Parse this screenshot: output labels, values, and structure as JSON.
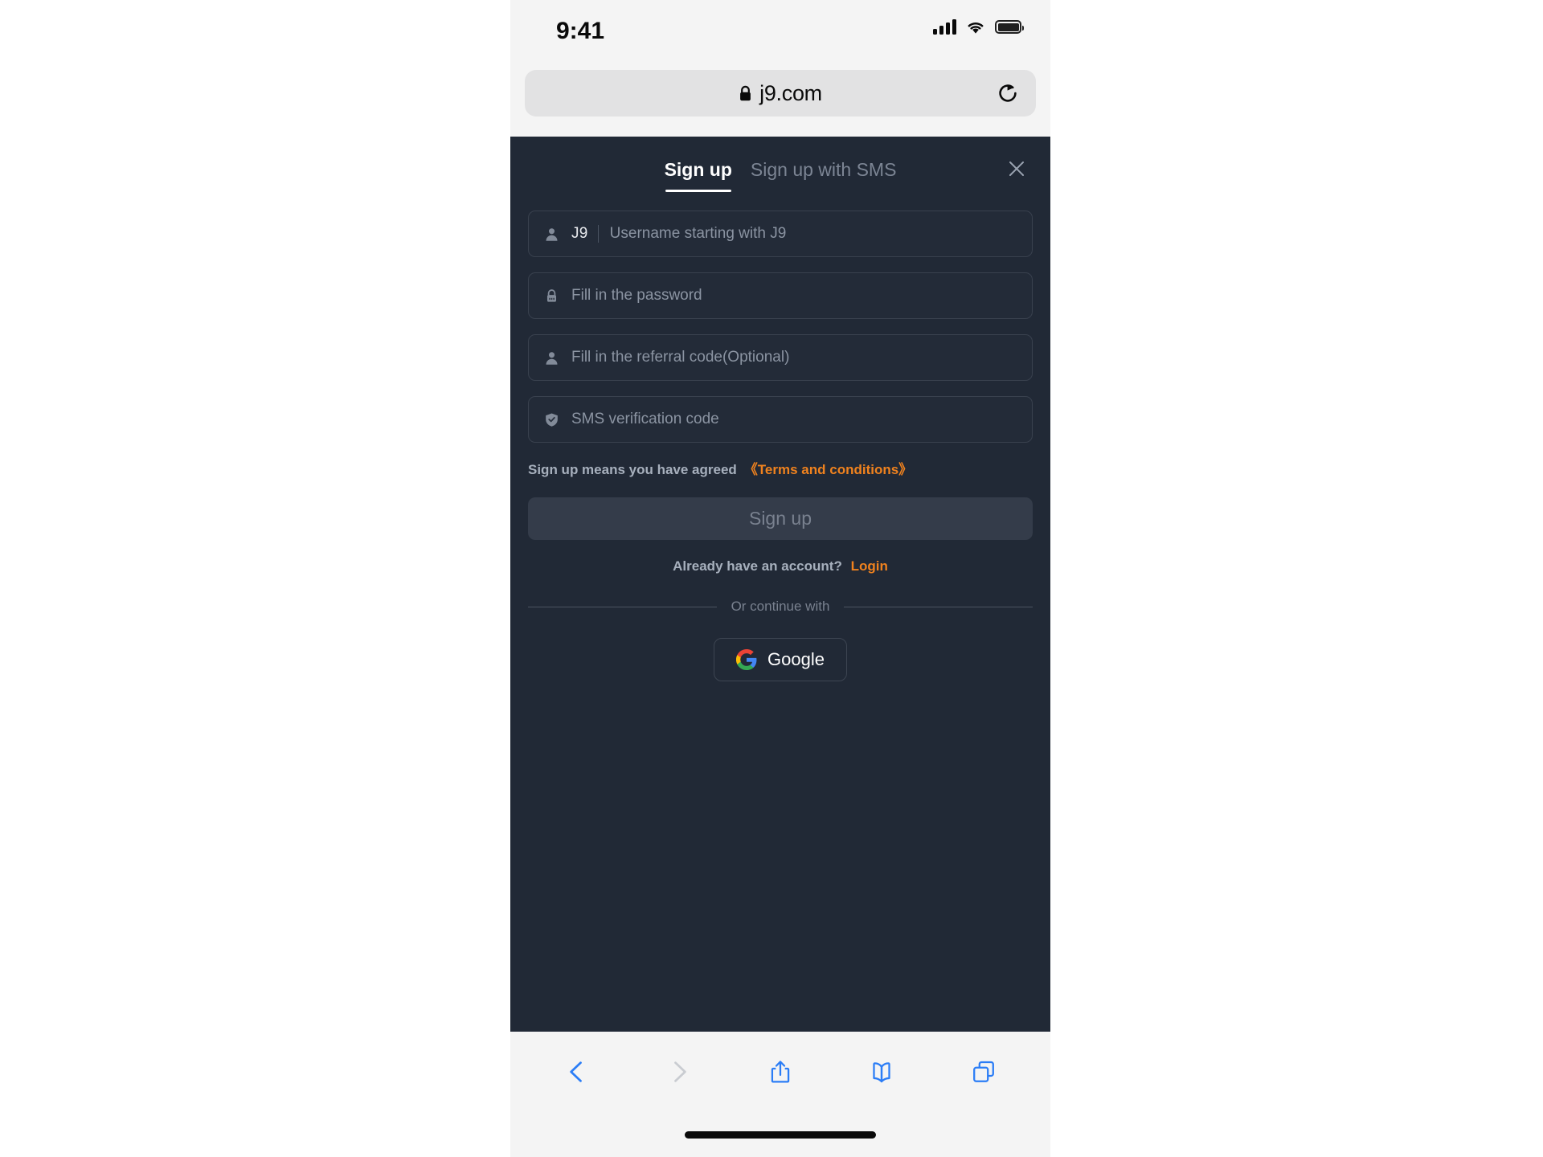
{
  "status_bar": {
    "time": "9:41",
    "signal_icon": "cellular-signal-icon",
    "wifi_icon": "wifi-icon",
    "battery_icon": "battery-icon"
  },
  "browser": {
    "url": "j9.com",
    "lock_icon": "lock-icon",
    "reload_icon": "reload-icon",
    "toolbar": {
      "back_label": "back-icon",
      "forward_label": "forward-icon",
      "share_label": "share-icon",
      "bookmarks_label": "book-icon",
      "tabs_label": "tabs-icon"
    }
  },
  "modal": {
    "tabs": [
      {
        "label": "Sign up",
        "active": true
      },
      {
        "label": "Sign up with SMS",
        "active": false
      }
    ],
    "close_icon": "close-icon",
    "fields": [
      {
        "name": "username",
        "icon": "person-icon",
        "prefix": "J9",
        "placeholder": "Username starting with J9",
        "value": ""
      },
      {
        "name": "password",
        "icon": "lock-icon",
        "prefix": "",
        "placeholder": "Fill in the password",
        "value": ""
      },
      {
        "name": "referral-code",
        "icon": "person-icon",
        "prefix": "",
        "placeholder": "Fill in the referral code(Optional)",
        "value": ""
      },
      {
        "name": "sms-verification-code",
        "icon": "shield-check-icon",
        "prefix": "",
        "placeholder": "SMS verification code",
        "value": ""
      }
    ],
    "terms": {
      "lead": "Sign up means you have agreed",
      "link": "《Terms and conditions》"
    },
    "submit_label": "Sign up",
    "login": {
      "lead": "Already have an account?",
      "link": "Login"
    },
    "divider_text": "Or continue with",
    "social": {
      "google_label": "Google",
      "google_icon": "google-icon"
    }
  },
  "colors": {
    "page_background": "#212936",
    "field_background": "#232b38",
    "field_border": "#39414e",
    "accent_orange": "#f0821e",
    "submit_background": "#343c4a",
    "submit_text": "#79818f",
    "chrome_background": "#f4f4f4",
    "address_background": "#e2e2e3",
    "toolbar_blue": "#2b7df6",
    "toolbar_disabled": "#c9ccd1"
  }
}
